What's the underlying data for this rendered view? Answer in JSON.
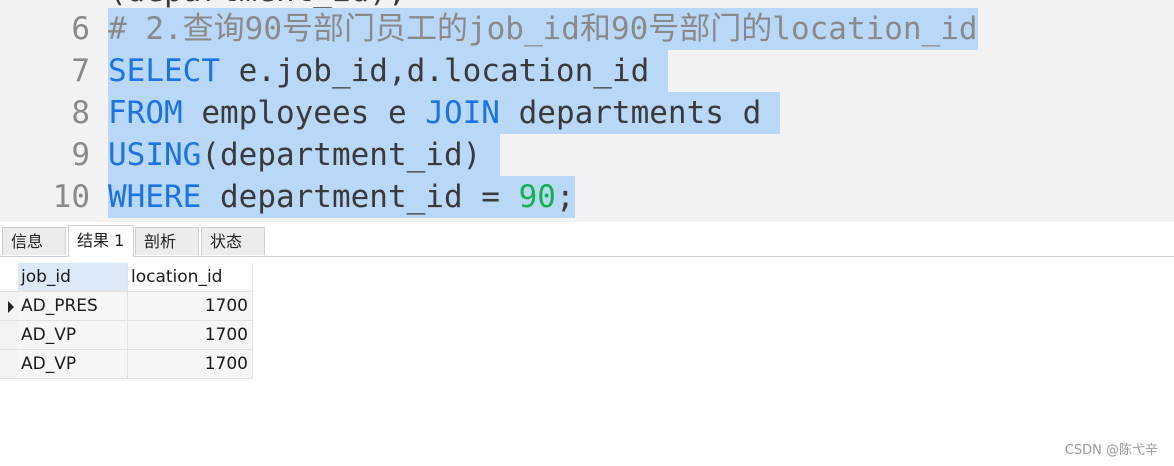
{
  "editor": {
    "partial_line": "(department_id);",
    "lines": [
      {
        "num": "6",
        "tokens": [
          {
            "t": "# 2.查询90号部门员工的job_id和90号部门的location_id",
            "c": "cm"
          }
        ]
      },
      {
        "num": "7",
        "tokens": [
          {
            "t": "SELECT",
            "c": "kw"
          },
          {
            "t": " e.job_id,d.location_id ",
            "c": "id"
          }
        ]
      },
      {
        "num": "8",
        "tokens": [
          {
            "t": "FROM",
            "c": "kw"
          },
          {
            "t": " employees e ",
            "c": "id"
          },
          {
            "t": "JOIN",
            "c": "kw"
          },
          {
            "t": " departments d ",
            "c": "id"
          }
        ]
      },
      {
        "num": "9",
        "tokens": [
          {
            "t": "USING",
            "c": "kw"
          },
          {
            "t": "(department_id) ",
            "c": "id"
          }
        ]
      },
      {
        "num": "10",
        "tokens": [
          {
            "t": "WHERE",
            "c": "kw"
          },
          {
            "t": " department_id = ",
            "c": "id"
          },
          {
            "t": "90",
            "c": "num"
          },
          {
            "t": ";",
            "c": "id"
          }
        ]
      }
    ]
  },
  "tabs": [
    {
      "label": "信息",
      "active": false
    },
    {
      "label": "结果 1",
      "active": true
    },
    {
      "label": "剖析",
      "active": false
    },
    {
      "label": "状态",
      "active": false
    }
  ],
  "result": {
    "columns": [
      "job_id",
      "location_id"
    ],
    "rows": [
      [
        "AD_PRES",
        "1700"
      ],
      [
        "AD_VP",
        "1700"
      ],
      [
        "AD_VP",
        "1700"
      ]
    ],
    "current_row": 0
  },
  "watermark": "CSDN @陈弋辛",
  "colors": {
    "selection": "#b9d8f8",
    "keyword": "#1a73e8",
    "number": "#12b24a",
    "comment": "#8a8a8a"
  }
}
